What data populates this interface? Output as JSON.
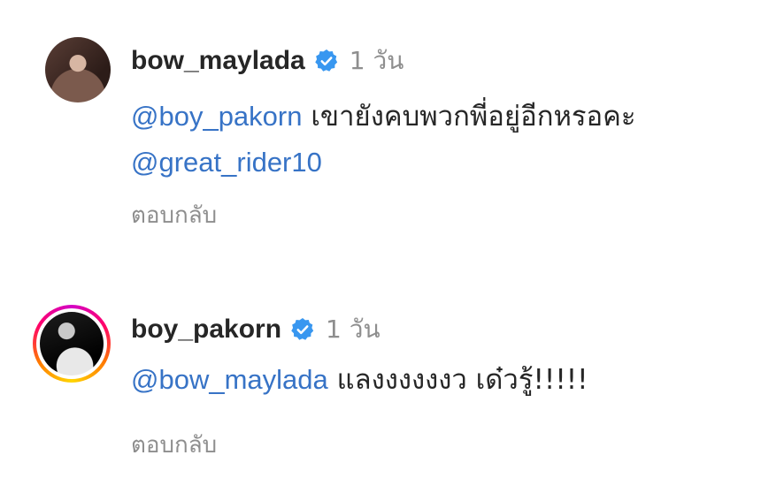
{
  "comments": [
    {
      "username": "bow_maylada",
      "verified": true,
      "time": "1 วัน",
      "mention1": "@boy_pakorn",
      "text1": " เขายังคบพวกพี่อยู่อีกหรอคะ",
      "mention2": "@great_rider10",
      "reply_label": "ตอบกลับ",
      "avatar_icon": "profile-photo"
    },
    {
      "username": "boy_pakorn",
      "verified": true,
      "time": "1 วัน",
      "mention1": "@bow_maylada",
      "text1": " แลงงงงงงว เด๋วรู้!!!!!",
      "reply_label": "ตอบกลับ",
      "avatar_icon": "profile-photo-story-ring"
    }
  ],
  "colors": {
    "mention": "#3773c6",
    "verified_badge": "#3897f0",
    "secondary_text": "#8e8e8e"
  }
}
